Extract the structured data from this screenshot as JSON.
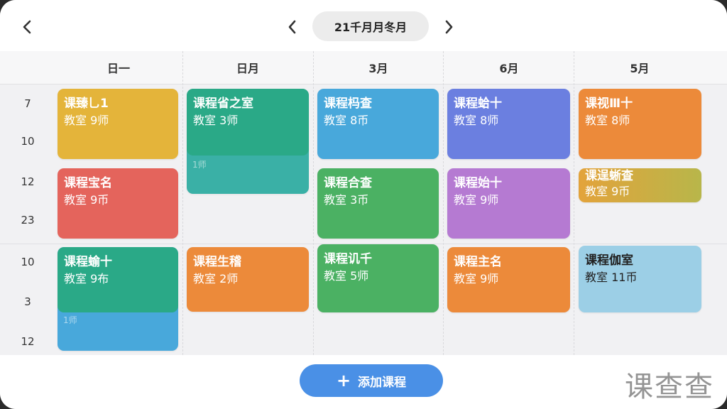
{
  "header": {
    "month_label": "21千月月冬月"
  },
  "days": [
    "日一",
    "日月",
    "3月",
    "6月",
    "5月"
  ],
  "times": [
    {
      "label": "7"
    },
    {
      "label": "10"
    },
    {
      "label": "12"
    },
    {
      "label": "23"
    },
    {
      "label": "10"
    },
    {
      "label": "3"
    },
    {
      "label": "12"
    }
  ],
  "courses": [
    {
      "name": "课臻乚1",
      "room": "教室 9师",
      "extra": "",
      "color": "yellow"
    },
    {
      "name": "课程宝名",
      "room": "教室 9币",
      "extra": "",
      "color": "red"
    },
    {
      "name": "课程蝓十",
      "room": "教室 9布",
      "extra": "1师",
      "color": "green-teal"
    },
    {
      "name": "课程省之室",
      "room": "教室 3师",
      "extra": "1师",
      "color": "green-teal"
    },
    {
      "name": "课程生稽",
      "room": "教室 2师",
      "extra": "",
      "color": "orange"
    },
    {
      "name": "课程杩查",
      "room": "教室 8币",
      "extra": "",
      "color": "blue"
    },
    {
      "name": "课程合查",
      "room": "教室 3币",
      "extra": "",
      "color": "green"
    },
    {
      "name": "课程讥千",
      "room": "教室 5师",
      "extra": "",
      "color": "green"
    },
    {
      "name": "课程蛤十",
      "room": "教室 8师",
      "extra": "",
      "color": "purple-blue"
    },
    {
      "name": "课程始十",
      "room": "教室 9师",
      "extra": "",
      "color": "purple"
    },
    {
      "name": "课程主名",
      "room": "教室 9师",
      "extra": "",
      "color": "orange"
    },
    {
      "name": "课视Ⅲ十",
      "room": "教室 8师",
      "extra": "",
      "color": "orange"
    },
    {
      "name": "课逞蜥查",
      "room": "教室 9币",
      "extra": "",
      "color": "olive"
    },
    {
      "name": "课程伽室",
      "room": "教室 11币",
      "extra": "",
      "color": "sky"
    }
  ],
  "actions": {
    "add_course": "添加课程"
  },
  "watermark": "课查查",
  "icons": {
    "back": "chevron-left-icon",
    "prev": "chevron-left-icon",
    "next": "chevron-right-icon",
    "add": "plus-icon"
  }
}
